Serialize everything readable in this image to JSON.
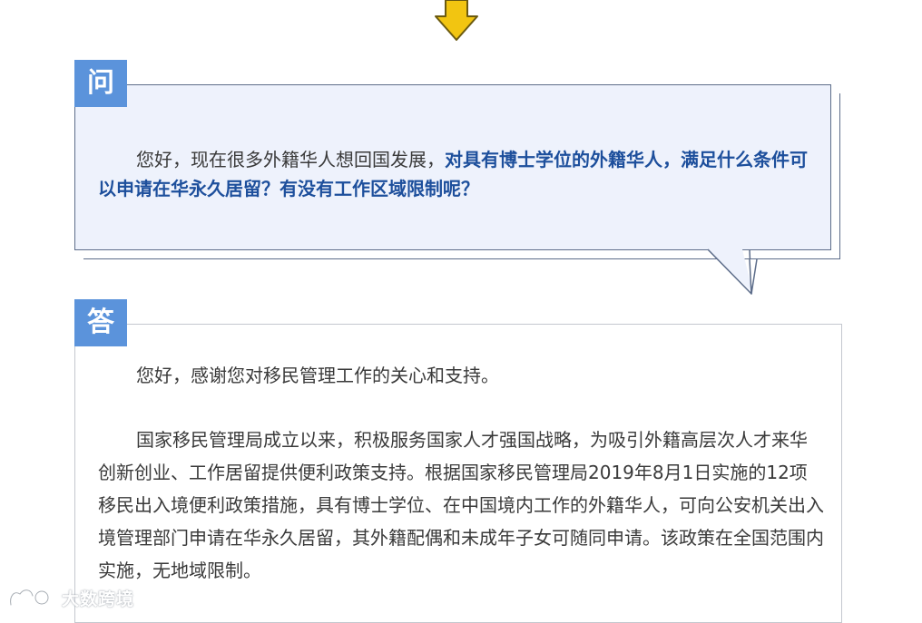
{
  "colors": {
    "label_bg": "#5b93db",
    "question_bubble_bg": "#eef2fc",
    "question_highlight": "#1d4f9c",
    "body_text": "#3a3a3a",
    "arrow_yellow": "#f2c511"
  },
  "icons": {
    "arrow": "arrow-down-icon",
    "watermark": "watermark-logo-icon"
  },
  "question": {
    "label": "问",
    "text_plain": "您好，现在很多外籍华人想回国发展，",
    "text_highlight": "对具有博士学位的外籍华人，满足什么条件可以申请在华永久居留？有没有工作区域限制呢？"
  },
  "answer": {
    "label": "答",
    "paragraphs": [
      "您好，感谢您对移民管理工作的关心和支持。",
      "国家移民管理局成立以来，积极服务国家人才强国战略，为吸引外籍高层次人才来华创新创业、工作居留提供便利政策支持。根据国家移民管理局2019年8月1日实施的12项移民出入境便利政策措施，具有博士学位、在中国境内工作的外籍华人，可向公安机关出入境管理部门申请在华永久居留，其外籍配偶和未成年子女可随同申请。该政策在全国范围内实施，无地域限制。"
    ]
  },
  "watermark": {
    "text": "大数跨境"
  }
}
